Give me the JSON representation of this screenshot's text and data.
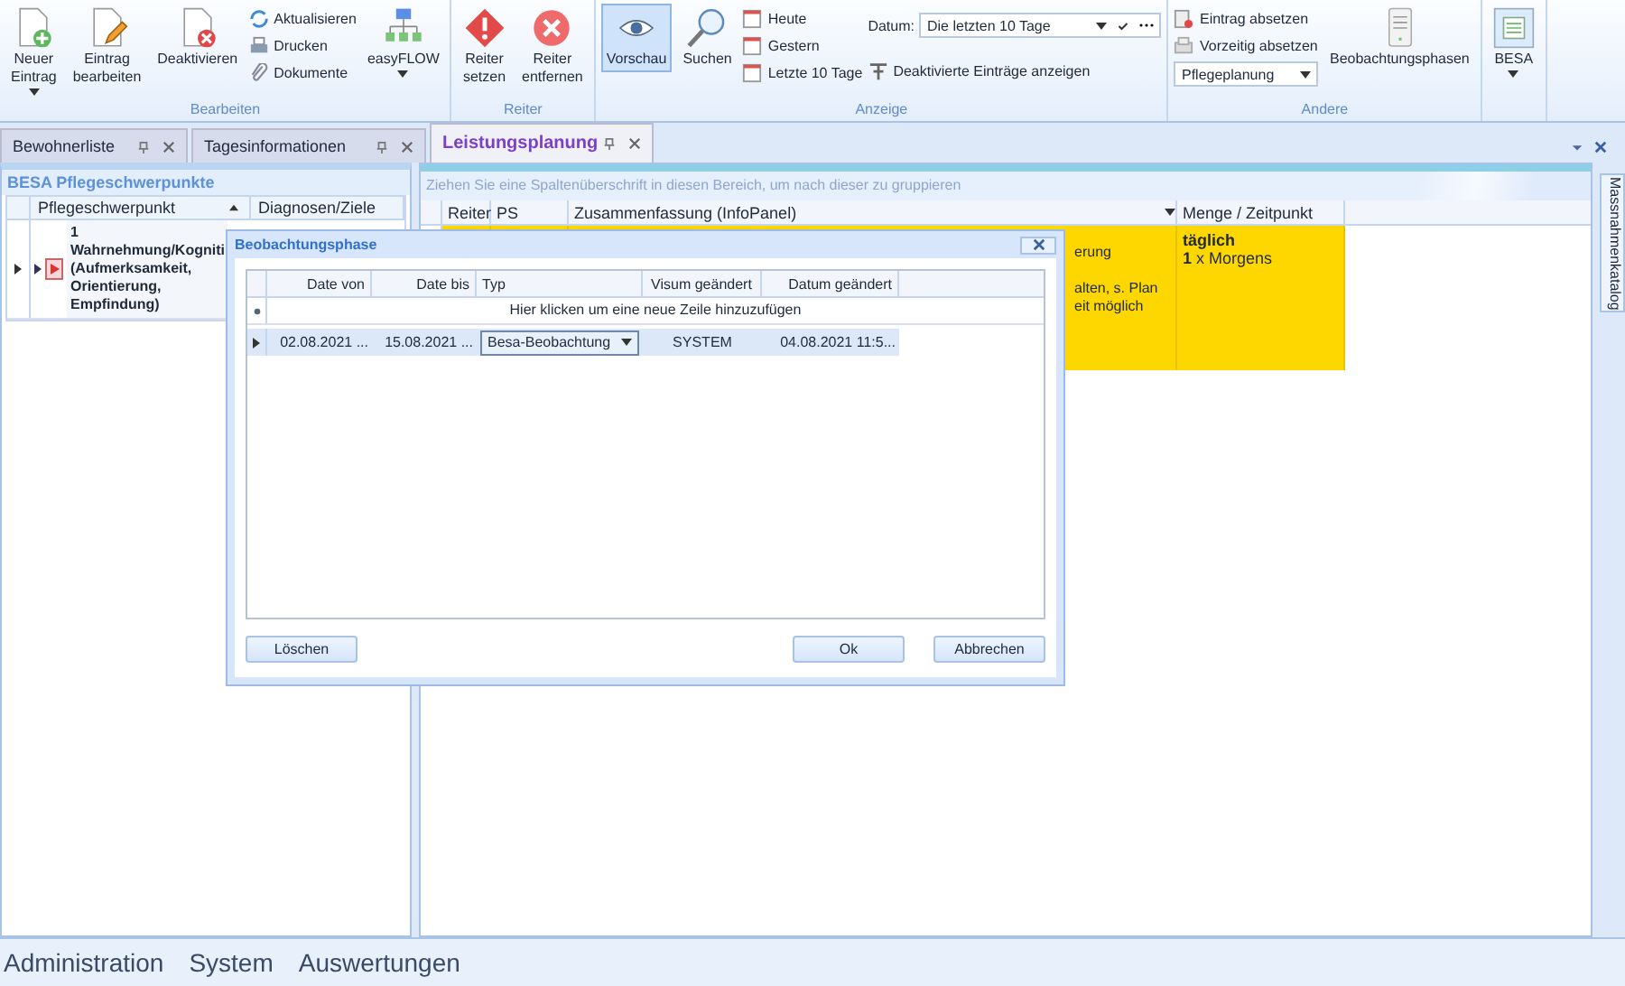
{
  "ribbon": {
    "groups": [
      {
        "label": "Bearbeiten",
        "large": [
          {
            "label": "Neuer Eintrag",
            "dropdown": true
          },
          {
            "label": "Eintrag bearbeiten",
            "dropdown": false
          },
          {
            "label": "Deaktivieren",
            "dropdown": false
          }
        ],
        "small": [
          {
            "label": "Aktualisieren"
          },
          {
            "label": "Drucken"
          },
          {
            "label": "Dokumente"
          }
        ],
        "after": [
          {
            "label": "easyFLOW",
            "dropdown": true
          }
        ]
      },
      {
        "label": "Reiter",
        "large": [
          {
            "label": "Reiter setzen",
            "dropdown": false
          },
          {
            "label": "Reiter entfernen",
            "dropdown": false
          }
        ]
      },
      {
        "label": "Anzeige",
        "large": [
          {
            "label": "Vorschau",
            "dropdown": false,
            "selected": true
          },
          {
            "label": "Suchen",
            "dropdown": false,
            "selected": false
          }
        ],
        "small": [
          {
            "label": "Heute"
          },
          {
            "label": "Gestern"
          },
          {
            "label": "Letzte 10 Tage"
          }
        ],
        "date_label": "Datum:",
        "date_value": "Die letzten 10 Tage",
        "toggle": "Deaktivierte Einträge anzeigen"
      },
      {
        "label": "Andere",
        "small": [
          {
            "label": "Eintrag absetzen"
          },
          {
            "label": "Vorzeitig absetzen"
          }
        ],
        "select_value": "Pflegeplanung",
        "after": [
          {
            "label": "Beobachtungsphasen",
            "dropdown": false
          }
        ]
      },
      {
        "after": [
          {
            "label": "BESA",
            "dropdown": true
          }
        ]
      }
    ]
  },
  "tabs": [
    {
      "label": "Bewohnerliste",
      "selected": false
    },
    {
      "label": "Tagesinformationen",
      "selected": false
    },
    {
      "label": "Leistungsplanung",
      "selected": true
    }
  ],
  "left_panel": {
    "title": "BESA Pflegeschwerpunkte",
    "columns": [
      "Pflegeschwerpunkt",
      "Diagnosen/Ziele"
    ],
    "rows": [
      {
        "number": "1",
        "lines": [
          "Wahrnehmung/Kogniti",
          "(Aufmerksamkeit,",
          "Orientierung,",
          "Empfindung)"
        ]
      }
    ]
  },
  "right_panel": {
    "group_hint": "Ziehen Sie eine Spaltenüberschrift in diesen Bereich, um nach dieser zu gruppieren",
    "columns": [
      "Reiter",
      "PS",
      "Zusammenfassung (InfoPanel)",
      "Menge / Zeitpunkt"
    ],
    "rows": [
      {
        "summary": [
          "erung",
          "alten, s. Plan",
          "eit möglich"
        ],
        "amount": [
          "täglich",
          "**1** x Morgens"
        ]
      }
    ],
    "side_tab": "Massnahmenkatalog"
  },
  "dialog": {
    "title": "Beobachtungsphase",
    "columns": [
      "Date von",
      "Date bis",
      "Typ",
      "Visum geändert",
      "Datum geändert"
    ],
    "new_row": "Hier klicken um eine neue Zeile hinzuzufügen",
    "rows": [
      {
        "cells": [
          "02.08.2021 ...",
          "15.08.2021 ...",
          "Besa-Beobachtung",
          "SYSTEM",
          "04.08.2021 11:5..."
        ]
      }
    ],
    "buttons": [
      "Löschen",
      "Ok",
      "Abbrechen"
    ]
  },
  "bottom_nav": [
    "Administration",
    "System",
    "Auswertungen"
  ]
}
